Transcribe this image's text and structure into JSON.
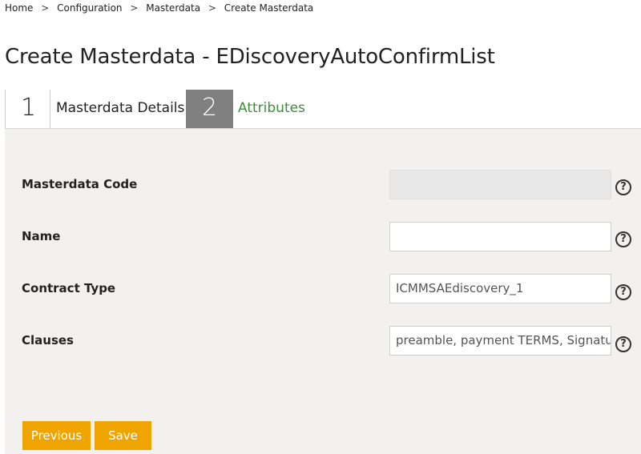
{
  "breadcrumb": {
    "items": [
      "Home",
      "Configuration",
      "Masterdata",
      "Create Masterdata"
    ],
    "separator": ">"
  },
  "page": {
    "title": "Create Masterdata - EDiscoveryAutoConfirmList"
  },
  "wizard": {
    "steps": [
      {
        "number": "1",
        "label": "Masterdata Details",
        "state": "active"
      },
      {
        "number": "2",
        "label": "Attributes",
        "state": "inactive"
      }
    ]
  },
  "form": {
    "fields": [
      {
        "label": "Masterdata Code",
        "value": "",
        "disabled": true
      },
      {
        "label": "Name",
        "value": "",
        "disabled": false
      },
      {
        "label": "Contract Type",
        "value": "ICMMSAEdiscovery_1",
        "disabled": false
      },
      {
        "label": "Clauses",
        "value": "preamble, payment TERMS, Signatur",
        "disabled": false
      }
    ],
    "help_glyph": "?"
  },
  "actions": {
    "previous_label": "Previous",
    "save_label": "Save"
  },
  "colors": {
    "accent_button": "#f0a400",
    "step_inactive_bg": "#808080",
    "link_green": "#3f8c3f",
    "panel_bg": "#f2f1ef"
  },
  "icons": {
    "help": "help-circle-icon"
  }
}
